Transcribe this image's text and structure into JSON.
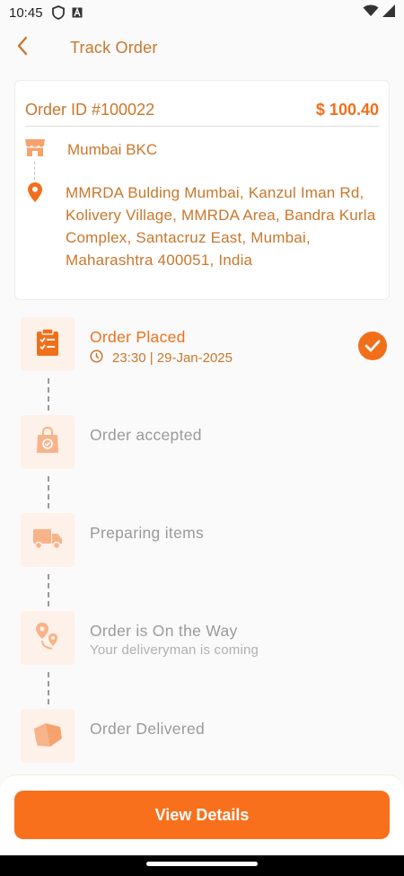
{
  "status_bar": {
    "time": "10:45",
    "icons": [
      "shield-icon",
      "a-icon",
      "wifi-icon",
      "signal-icon"
    ]
  },
  "header": {
    "title": "Track Order",
    "back_icon": "chevron-left-icon"
  },
  "order": {
    "id_label": "Order ID #100022",
    "total": "$ 100.40",
    "store_name": "Mumbai BKC",
    "store_icon": "store-icon",
    "location_icon": "location-pin-icon",
    "address": "MMRDA Bulding Mumbai, Kanzul Iman Rd, Kolivery Village, MMRDA Area, Bandra Kurla Complex, Santacruz East, Mumbai, Maharashtra 400051, India"
  },
  "steps": [
    {
      "title": "Order Placed",
      "time": "23:30 | 29-Jan-2025",
      "icon": "clipboard-icon",
      "status": "completed"
    },
    {
      "title": "Order accepted",
      "icon": "shopping-bag-icon",
      "status": "pending"
    },
    {
      "title": "Preparing items",
      "icon": "truck-icon",
      "status": "pending"
    },
    {
      "title": "Order is On the Way",
      "subtitle": "Your deliveryman is coming",
      "icon": "route-icon",
      "status": "pending"
    },
    {
      "title": "Order Delivered",
      "icon": "package-icon",
      "status": "pending"
    }
  ],
  "footer": {
    "button_label": "View Details"
  },
  "colors": {
    "accent": "#f26f1a",
    "accent_text": "#c9772c",
    "icon_bg": "#fdf1ea",
    "muted_text": "#9a9a9a"
  }
}
